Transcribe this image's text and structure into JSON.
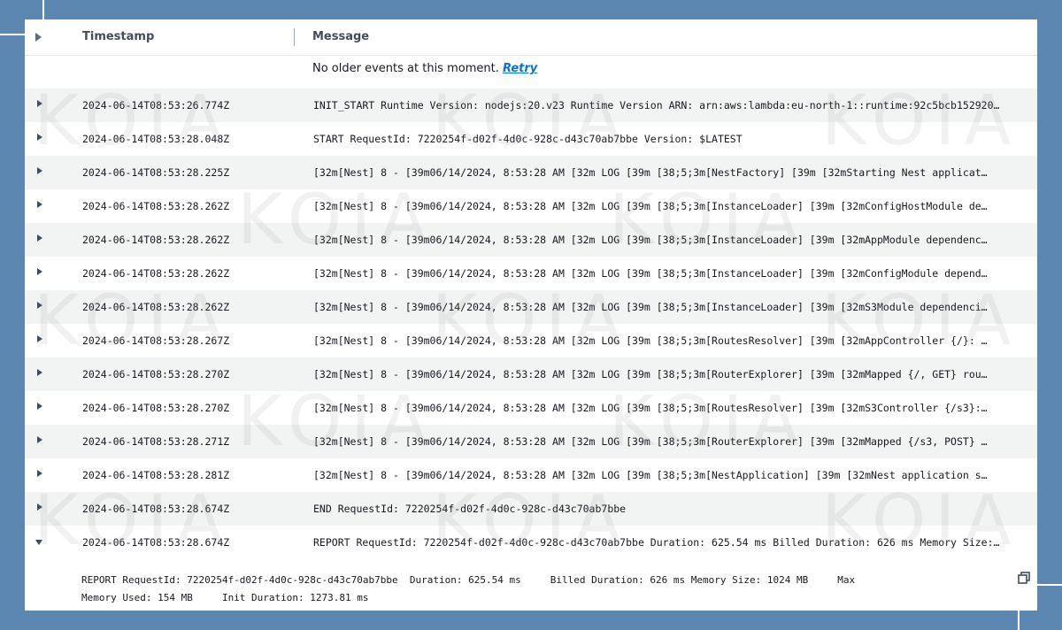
{
  "header": {
    "timestamp_label": "Timestamp",
    "message_label": "Message"
  },
  "notice": {
    "text": "No older events at this moment. ",
    "retry_label": "Retry"
  },
  "events": [
    {
      "timestamp": "2024-06-14T08:53:26.774Z",
      "message": "INIT_START Runtime Version: nodejs:20.v23 Runtime Version ARN: arn:aws:lambda:eu-north-1::runtime:92c5bcb152920…"
    },
    {
      "timestamp": "2024-06-14T08:53:28.048Z",
      "message": "START RequestId: 7220254f-d02f-4d0c-928c-d43c70ab7bbe Version: $LATEST"
    },
    {
      "timestamp": "2024-06-14T08:53:28.225Z",
      "message": " [32m[Nest] 8 - [39m06/14/2024, 8:53:28 AM [32m LOG [39m [38;5;3m[NestFactory] [39m [32mStarting Nest applicat…"
    },
    {
      "timestamp": "2024-06-14T08:53:28.262Z",
      "message": " [32m[Nest] 8 - [39m06/14/2024, 8:53:28 AM [32m LOG [39m [38;5;3m[InstanceLoader] [39m [32mConfigHostModule de…"
    },
    {
      "timestamp": "2024-06-14T08:53:28.262Z",
      "message": " [32m[Nest] 8 - [39m06/14/2024, 8:53:28 AM [32m LOG [39m [38;5;3m[InstanceLoader] [39m [32mAppModule dependenc…"
    },
    {
      "timestamp": "2024-06-14T08:53:28.262Z",
      "message": " [32m[Nest] 8 - [39m06/14/2024, 8:53:28 AM [32m LOG [39m [38;5;3m[InstanceLoader] [39m [32mConfigModule depend…"
    },
    {
      "timestamp": "2024-06-14T08:53:28.262Z",
      "message": " [32m[Nest] 8 - [39m06/14/2024, 8:53:28 AM [32m LOG [39m [38;5;3m[InstanceLoader] [39m [32mS3Module dependenci…"
    },
    {
      "timestamp": "2024-06-14T08:53:28.267Z",
      "message": " [32m[Nest] 8 - [39m06/14/2024, 8:53:28 AM [32m LOG [39m [38;5;3m[RoutesResolver] [39m [32mAppController {/}: …"
    },
    {
      "timestamp": "2024-06-14T08:53:28.270Z",
      "message": " [32m[Nest] 8 - [39m06/14/2024, 8:53:28 AM [32m LOG [39m [38;5;3m[RouterExplorer] [39m [32mMapped {/, GET} rou…"
    },
    {
      "timestamp": "2024-06-14T08:53:28.270Z",
      "message": " [32m[Nest] 8 - [39m06/14/2024, 8:53:28 AM [32m LOG [39m [38;5;3m[RoutesResolver] [39m [32mS3Controller {/s3}:…"
    },
    {
      "timestamp": "2024-06-14T08:53:28.271Z",
      "message": " [32m[Nest] 8 - [39m06/14/2024, 8:53:28 AM [32m LOG [39m [38;5;3m[RouterExplorer] [39m [32mMapped {/s3, POST} …"
    },
    {
      "timestamp": "2024-06-14T08:53:28.281Z",
      "message": " [32m[Nest] 8 - [39m06/14/2024, 8:53:28 AM [32m LOG [39m [38;5;3m[NestApplication] [39m [32mNest application s…"
    },
    {
      "timestamp": "2024-06-14T08:53:28.674Z",
      "message": "END RequestId: 7220254f-d02f-4d0c-928c-d43c70ab7bbe"
    },
    {
      "timestamp": "2024-06-14T08:53:28.674Z",
      "message": "REPORT RequestId: 7220254f-d02f-4d0c-928c-d43c70ab7bbe Duration: 625.54 ms Billed Duration: 626 ms Memory Size:…",
      "expanded": true
    }
  ],
  "detail": {
    "line1": "REPORT RequestId: 7220254f-d02f-4d0c-928c-d43c70ab7bbe  Duration: 625.54 ms     Billed Duration: 626 ms Memory Size: 1024 MB     Max",
    "line2": "Memory Used: 154 MB     Init Duration: 1273.81 ms"
  },
  "watermark": "KOIA",
  "colors": {
    "background": "#5b87b0",
    "link": "#0972d3",
    "row_shade": "#f2f3f3"
  }
}
